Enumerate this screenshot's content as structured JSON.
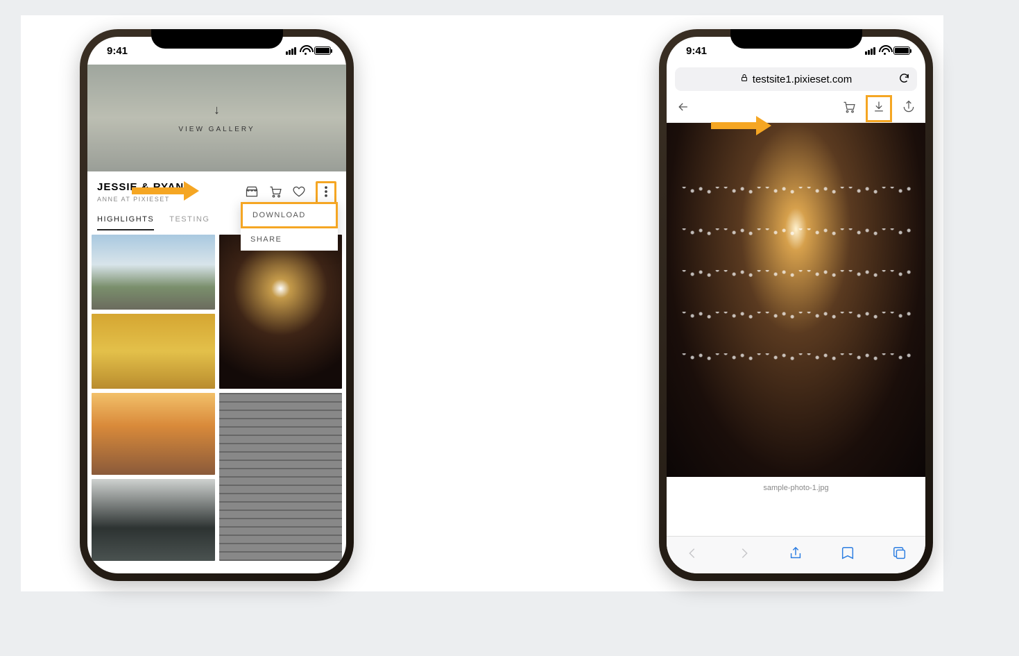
{
  "status": {
    "time": "9:41"
  },
  "phone1": {
    "hero": {
      "label": "VIEW GALLERY"
    },
    "title": "JESSIE & RYAN",
    "subtitle": "ANNE AT PIXIESET",
    "tabs": [
      "HIGHLIGHTS",
      "TESTING"
    ],
    "dropdown": {
      "download": "DOWNLOAD",
      "share": "SHARE"
    }
  },
  "phone2": {
    "url": "testsite1.pixieset.com",
    "caption": "sample-photo-1.jpg"
  }
}
